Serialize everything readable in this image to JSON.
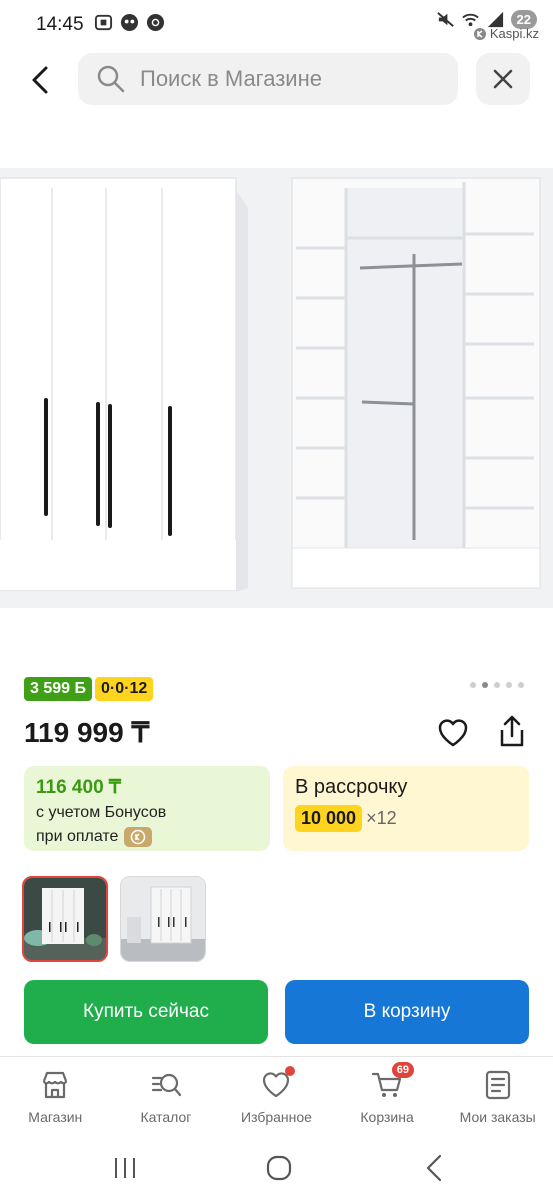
{
  "status": {
    "time": "14:45",
    "battery": "22",
    "app_tag": "Kaspi.kz"
  },
  "header": {
    "search_placeholder": "Поиск в Магазине"
  },
  "product": {
    "bonus_badge": "3 599 Б",
    "installment_badge": "0·0·12",
    "price": "119 999 ₸",
    "image_count": 5,
    "active_image": 2
  },
  "bonus_card": {
    "price": "116 400 ₸",
    "line1": "с учетом Бонусов",
    "line2": "при оплате"
  },
  "installment_card": {
    "label": "В рассрочку",
    "amount": "10 000",
    "times": "×12"
  },
  "buttons": {
    "buy_now": "Купить сейчас",
    "to_cart": "В корзину"
  },
  "bottom_nav": {
    "items": [
      {
        "label": "Магазин",
        "icon": "store-icon"
      },
      {
        "label": "Каталог",
        "icon": "catalog-search-icon"
      },
      {
        "label": "Избранное",
        "icon": "heart-icon"
      },
      {
        "label": "Корзина",
        "icon": "cart-icon",
        "badge": "69"
      },
      {
        "label": "Мои заказы",
        "icon": "orders-icon"
      }
    ]
  },
  "colors": {
    "bonus_green": "#3fa017",
    "installment_yellow": "#ffd41e",
    "buy_green": "#1fae4b",
    "cart_blue": "#1677d6",
    "notification_red": "#e0443a"
  }
}
